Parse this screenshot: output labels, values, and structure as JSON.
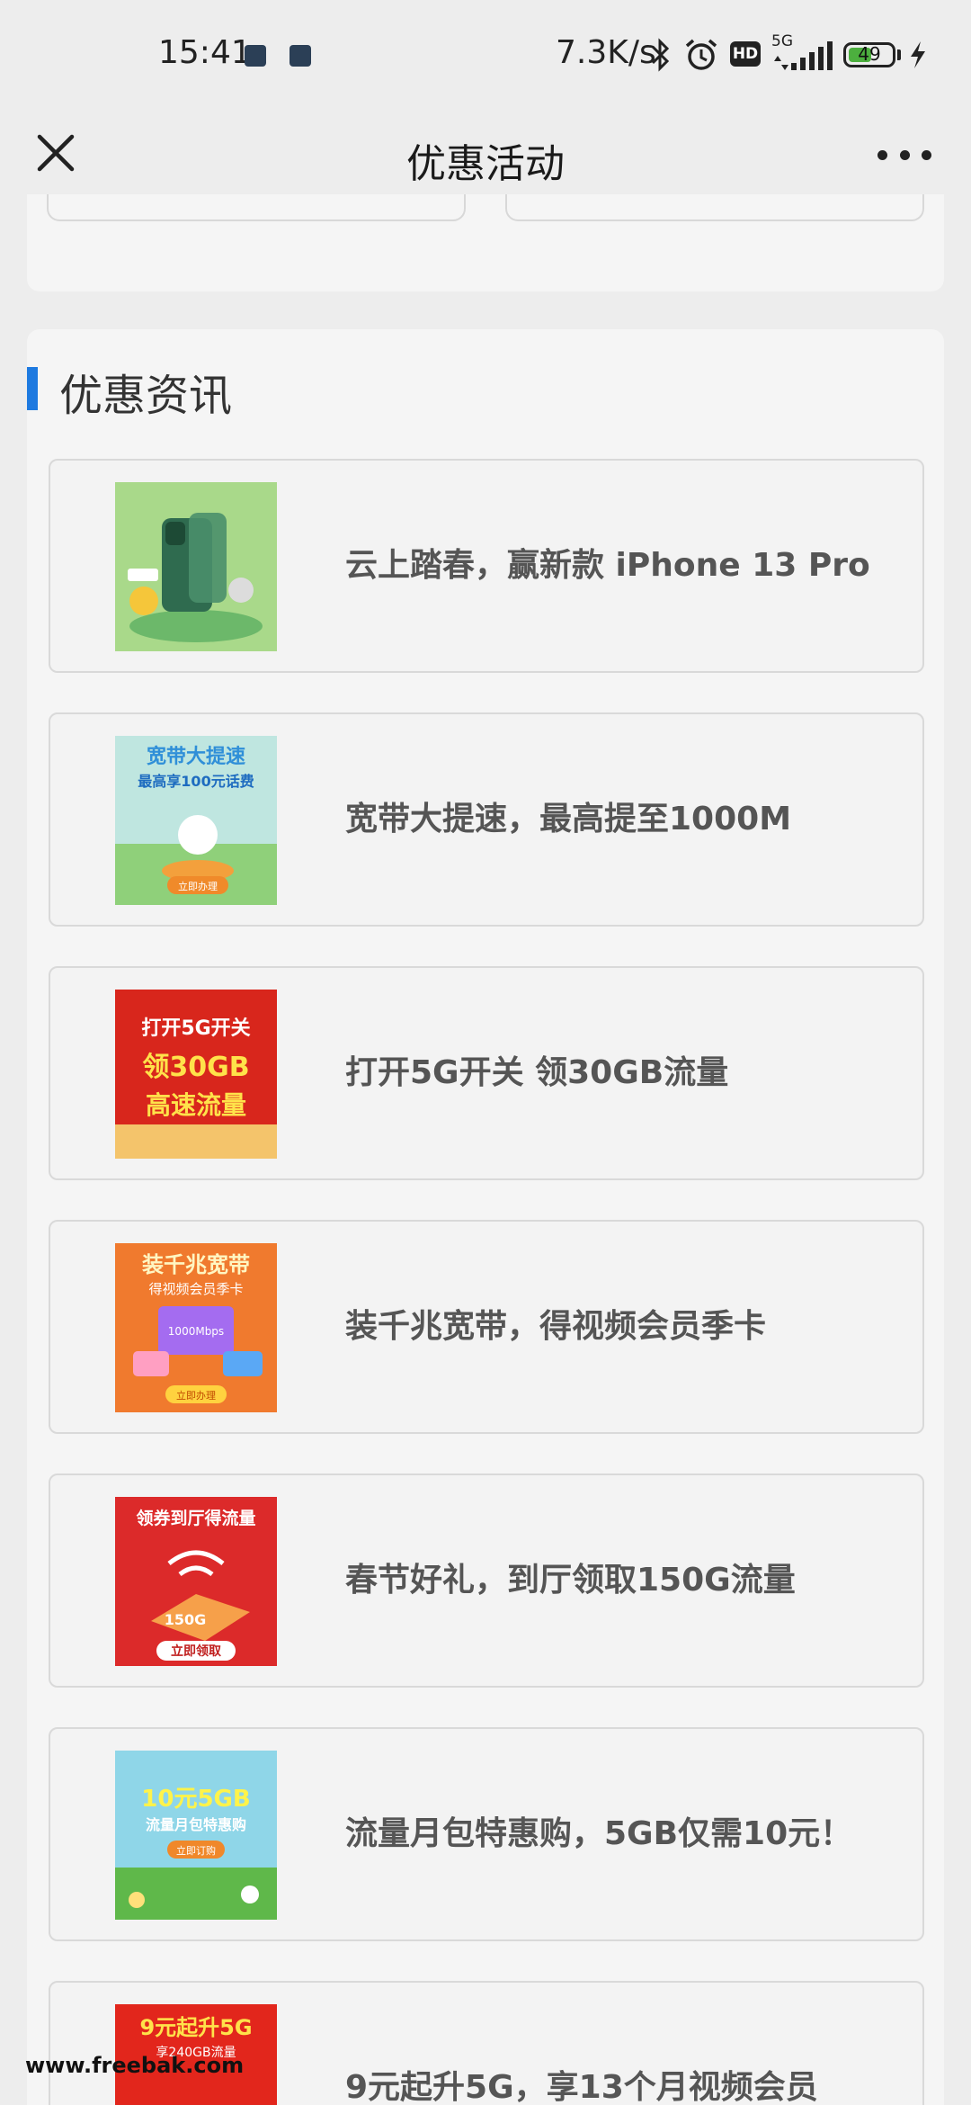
{
  "status_bar": {
    "time": "15:41",
    "net_speed": "7.3K/s",
    "hd_label": "HD",
    "network_type": "5G",
    "battery_level": "49",
    "battery_percent": 49,
    "icons": [
      "app-notification-icon",
      "app-notification-icon",
      "bluetooth-icon",
      "alarm-icon",
      "hd-icon",
      "signal-icon",
      "battery-icon",
      "charging-icon"
    ]
  },
  "nav": {
    "title": "优惠活动",
    "close_icon": "close-icon",
    "more_icon": "more-icon"
  },
  "section": {
    "title": "优惠资讯",
    "accent_color": "#1e7ae0"
  },
  "items": [
    {
      "title": "云上踏春，赢新款 iPhone 13 Pro",
      "image": "promo-image-iphone"
    },
    {
      "title": "宽带大提速，最高提至1000M",
      "image": "promo-image-broadband",
      "banner_line1": "宽带大提速",
      "banner_line2": "最高享100元话费",
      "button": "立即办理"
    },
    {
      "title": "打开5G开关 领30GB流量",
      "image": "promo-image-5g",
      "banner_line1": "打开5G开关",
      "banner_line2": "领30GB",
      "banner_line3": "高速流量"
    },
    {
      "title": "装千兆宽带，得视频会员季卡",
      "image": "promo-image-gigabit",
      "banner_line1": "装千兆宽带",
      "banner_line2": "得视频会员季卡",
      "banner_speed": "1000Mbps",
      "button": "立即办理"
    },
    {
      "title": "春节好礼，到厅领取150G流量",
      "image": "promo-image-150g",
      "banner_line1": "领券到厅得流量",
      "banner_value": "150G",
      "button": "立即领取"
    },
    {
      "title": "流量月包特惠购，5GB仅需10元！",
      "image": "promo-image-5gb",
      "banner_line1": "10元5GB",
      "banner_line2": "流量月包特惠购",
      "button": "立即订购"
    },
    {
      "title": "9元起升5G，享13个月视频会员",
      "image": "promo-image-9yuan",
      "banner_line1": "9元起升5G",
      "banner_line2": "享240GB流量"
    }
  ],
  "watermark": "www.freebak.com"
}
